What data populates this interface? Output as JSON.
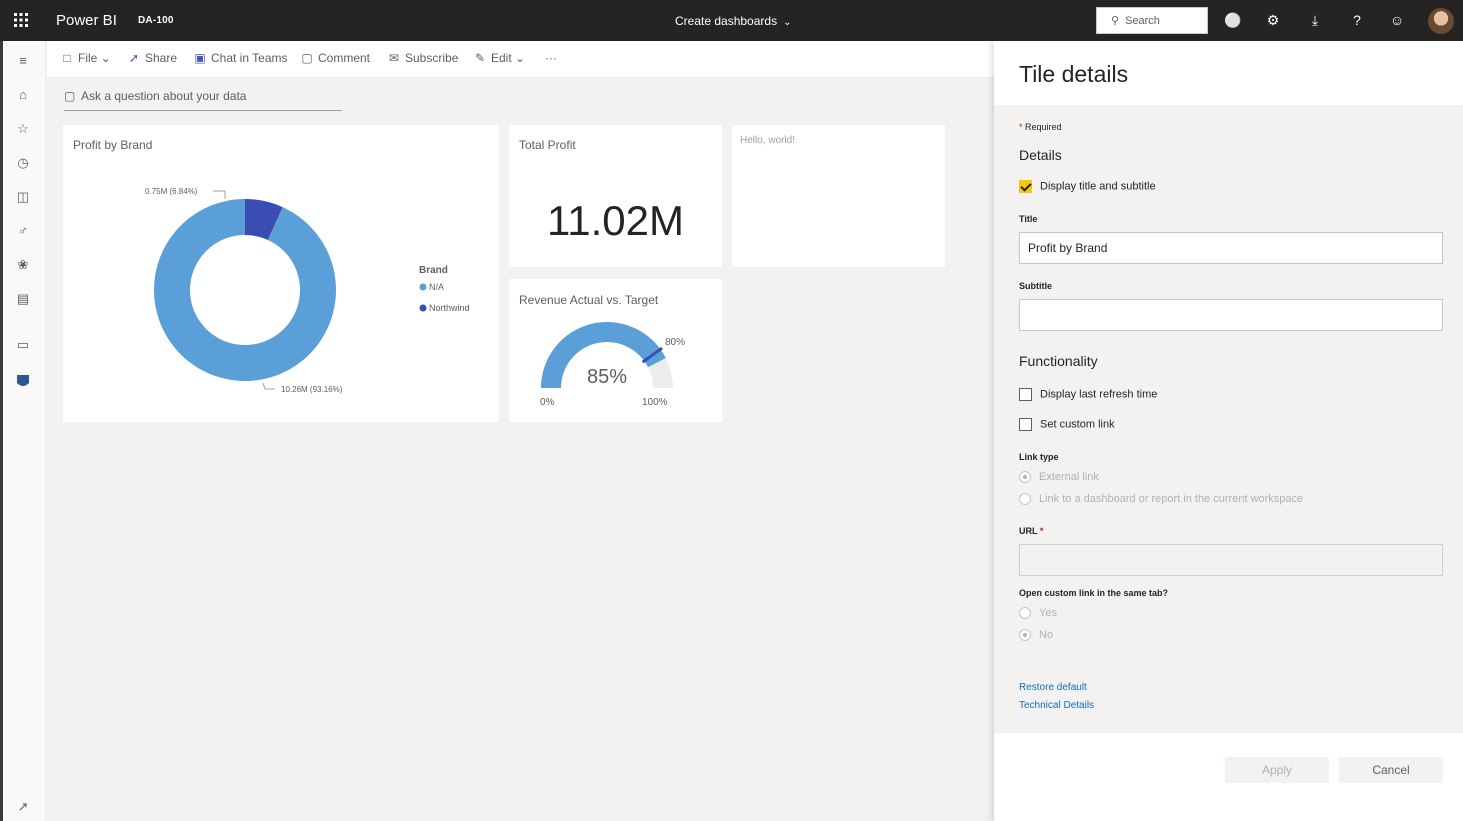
{
  "header": {
    "app_title": "Power BI",
    "workspace": "DA-100",
    "center_title": "Create dashboards",
    "search_placeholder": "Search"
  },
  "toolbar": {
    "file": "File",
    "share": "Share",
    "chat": "Chat in Teams",
    "comment": "Comment",
    "subscribe": "Subscribe",
    "edit": "Edit",
    "more": "···"
  },
  "qna": {
    "placeholder": "Ask a question about your data"
  },
  "tiles": {
    "profit_by_brand": {
      "title": "Profit by Brand",
      "label_small": "0.75M (6.84%)",
      "label_large": "10.26M (93.16%)",
      "legend_title": "Brand",
      "legend_items": [
        "N/A",
        "Northwind"
      ]
    },
    "total_profit": {
      "title": "Total Profit",
      "value": "11.02M"
    },
    "hello": {
      "text": "Hello, world!"
    },
    "gauge": {
      "title": "Revenue Actual vs. Target",
      "value_label": "85%",
      "target_label": "80%",
      "min_label": "0%",
      "max_label": "100%"
    }
  },
  "chart_data": [
    {
      "type": "pie",
      "title": "Profit by Brand",
      "categories": [
        "N/A",
        "Northwind"
      ],
      "values": [
        10.26,
        0.75
      ],
      "percent": [
        93.16,
        6.84
      ],
      "unit": "M",
      "colors": [
        "#5a9fd8",
        "#3b4cb3"
      ],
      "legend": "right"
    },
    {
      "type": "gauge",
      "title": "Revenue Actual vs. Target",
      "value": 85,
      "target": 80,
      "min": 0,
      "max": 100,
      "colors": {
        "fill": "#5a9fd8",
        "background": "#ededed",
        "target": "#3b4cb3"
      }
    }
  ],
  "pane": {
    "title": "Tile details",
    "required": "Required",
    "details_heading": "Details",
    "display_title_subtitle": "Display title and subtitle",
    "title_label": "Title",
    "title_value": "Profit by Brand",
    "subtitle_label": "Subtitle",
    "subtitle_value": "",
    "functionality_heading": "Functionality",
    "display_refresh": "Display last refresh time",
    "set_custom_link": "Set custom link",
    "link_type_label": "Link type",
    "external_link": "External link",
    "link_dashboard": "Link to a dashboard or report in the current workspace",
    "url_label": "URL",
    "url_value": "",
    "same_tab_label": "Open custom link in the same tab?",
    "yes": "Yes",
    "no": "No",
    "restore_default": "Restore default",
    "technical_details": "Technical Details",
    "apply": "Apply",
    "cancel": "Cancel"
  },
  "colors": {
    "header_bg": "#252423",
    "accent_yellow": "#f2c811",
    "link_blue": "#106ebe"
  },
  "icons": [
    "waffle-icon",
    "notification-icon",
    "settings-icon",
    "download-icon",
    "help-icon",
    "feedback-icon",
    "home-icon",
    "favorites-icon",
    "recent-icon",
    "apps-icon",
    "shared-icon",
    "learn-icon",
    "workspaces-icon",
    "workspace-icon",
    "expand-icon"
  ]
}
